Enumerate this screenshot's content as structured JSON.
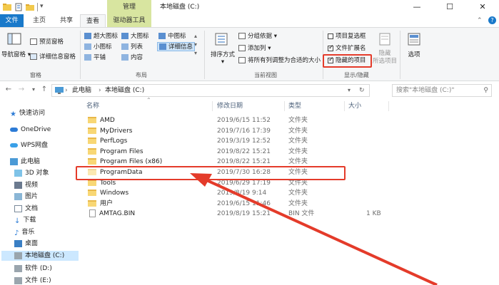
{
  "titlebar": {
    "context_tab": "管理",
    "title": "本地磁盘 (C:)",
    "minimize": "—",
    "maximize": "☐",
    "close": "✕"
  },
  "tabs": [
    "文件",
    "主页",
    "共享",
    "查看",
    "驱动器工具"
  ],
  "ribbon": {
    "pane_group": {
      "nav_pane": "导航窗格",
      "preview_pane": "预览窗格",
      "details_pane": "详细信息窗格",
      "label": "窗格"
    },
    "layout_group": {
      "items": [
        "超大图标",
        "大图标",
        "中图标",
        "小图标",
        "列表",
        "详细信息",
        "平铺",
        "内容"
      ],
      "label": "布局"
    },
    "current_view_group": {
      "sort": "排序方式",
      "group_by": "分组依据",
      "add_columns": "添加列",
      "fit_columns": "将所有列调整为合适的大小",
      "label": "当前视图"
    },
    "show_hide_group": {
      "item_checkboxes": "项目复选框",
      "file_extensions": "文件扩展名",
      "hidden_items": "隐藏的项目",
      "hide_selected": "隐藏",
      "hide_selected_2": "所选项目",
      "label": "显示/隐藏",
      "item_checkboxes_checked": false,
      "file_extensions_checked": true,
      "hidden_items_checked": true
    },
    "options": "选项"
  },
  "addressbar": {
    "crumbs": [
      "此电脑",
      "本地磁盘 (C:)"
    ],
    "search_placeholder": "搜索\"本地磁盘 (C:)\""
  },
  "navpane": {
    "items": [
      "快速访问",
      "OneDrive",
      "WPS网盘",
      "此电脑",
      "3D 对象",
      "视频",
      "图片",
      "文档",
      "下载",
      "音乐",
      "桌面",
      "本地磁盘 (C:)",
      "软件 (D:)",
      "文件 (E:)"
    ]
  },
  "columns": [
    "名称",
    "修改日期",
    "类型",
    "大小"
  ],
  "files": [
    {
      "name": "AMD",
      "date": "2019/6/15 11:52",
      "type": "文件夹",
      "size": ""
    },
    {
      "name": "MyDrivers",
      "date": "2019/7/16 17:39",
      "type": "文件夹",
      "size": ""
    },
    {
      "name": "PerfLogs",
      "date": "2019/3/19 12:52",
      "type": "文件夹",
      "size": ""
    },
    {
      "name": "Program Files",
      "date": "2019/8/22 15:21",
      "type": "文件夹",
      "size": ""
    },
    {
      "name": "Program Files (x86)",
      "date": "2019/8/22 15:21",
      "type": "文件夹",
      "size": ""
    },
    {
      "name": "ProgramData",
      "date": "2019/7/30 16:28",
      "type": "文件夹",
      "size": ""
    },
    {
      "name": "Tools",
      "date": "2019/6/29 17:19",
      "type": "文件夹",
      "size": ""
    },
    {
      "name": "Windows",
      "date": "2019/8/19 9:14",
      "type": "文件夹",
      "size": ""
    },
    {
      "name": "用户",
      "date": "2019/6/15 11:46",
      "type": "文件夹",
      "size": ""
    },
    {
      "name": "AMTAG.BIN",
      "date": "2019/8/19 15:21",
      "type": "BIN 文件",
      "size": "1 KB"
    }
  ],
  "colors": {
    "annotation_red": "#e43b2a",
    "file_tab": "#1979ca",
    "drive_tools_tab": "#d8e5a0"
  }
}
